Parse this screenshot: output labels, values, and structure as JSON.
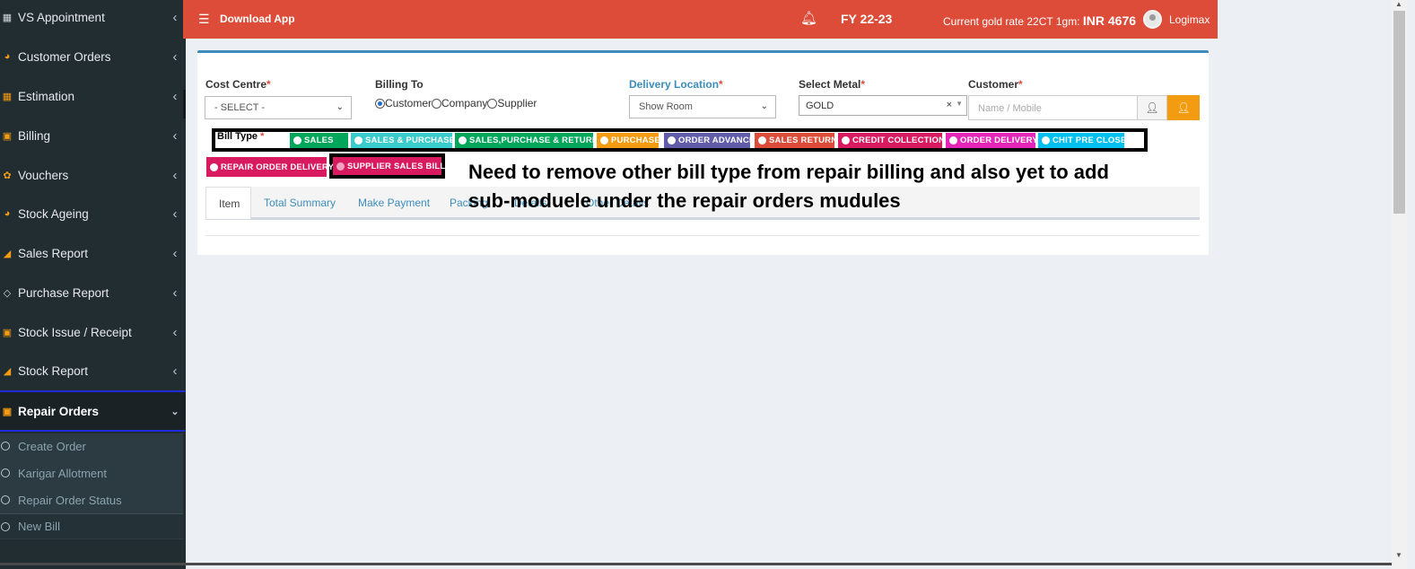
{
  "sidebar": {
    "items": [
      {
        "label": "VS Appointment",
        "icon": "calendar-icon"
      },
      {
        "label": "Customer Orders",
        "icon": "pie-chart-icon"
      },
      {
        "label": "Estimation",
        "icon": "calculator-icon"
      },
      {
        "label": "Billing",
        "icon": "money-icon"
      },
      {
        "label": "Vouchers",
        "icon": "gift-icon"
      },
      {
        "label": "Stock Ageing",
        "icon": "pie-chart-icon"
      },
      {
        "label": "Sales Report",
        "icon": "area-chart-icon"
      },
      {
        "label": "Purchase Report",
        "icon": "diamond-icon"
      },
      {
        "label": "Stock Issue / Receipt",
        "icon": "money-icon"
      },
      {
        "label": "Stock Report",
        "icon": "area-chart-icon"
      }
    ],
    "active": {
      "label": "Repair Orders",
      "icon": "money-icon"
    },
    "submenu": [
      "Create Order",
      "Karigar Allotment",
      "Repair Order Status",
      "New Bill"
    ]
  },
  "header": {
    "menu_icon": "hamburger-icon",
    "download_app": "Download App",
    "bell_icon": "bell-icon",
    "fy": "FY 22-23",
    "gold_rate_label": "Current gold rate 22CT 1gm:",
    "gold_rate_value": "INR 4676",
    "user": "Logimax",
    "brand_color": "#dd4b39"
  },
  "form": {
    "cost_centre": {
      "label": "Cost Centre",
      "required": "*",
      "value": "- SELECT -"
    },
    "billing_to": {
      "label": "Billing To",
      "options": [
        "Customer",
        "Company",
        "Supplier"
      ],
      "selected": "Customer"
    },
    "delivery_location": {
      "label": "Delivery Location",
      "required": "*",
      "value": "Show Room"
    },
    "select_metal": {
      "label": "Select Metal",
      "required": "*",
      "value": "GOLD",
      "clear": "×"
    },
    "customer": {
      "label": "Customer",
      "required": "*",
      "placeholder": "Name / Mobile"
    }
  },
  "bill_type": {
    "label": "Bill Type",
    "required": "*",
    "options": [
      {
        "label": "SALES",
        "color": "#00a65a"
      },
      {
        "label": "SALES & PURCHASE",
        "color": "#39cccc"
      },
      {
        "label": "SALES,PURCHASE & RETURN",
        "color": "#00a65a"
      },
      {
        "label": "PURCHASE",
        "color": "#f39c12"
      },
      {
        "label": "ORDER ADVANCE",
        "color": "#605ca8"
      },
      {
        "label": "SALES RETURN",
        "color": "#dd4b39"
      },
      {
        "label": "CREDIT COLLECTION",
        "color": "#d81b60"
      },
      {
        "label": "ORDER DELIVERY",
        "color": "#e426b8"
      },
      {
        "label": "CHIT PRE CLOSE",
        "color": "#00c0ef"
      },
      {
        "label": "REPAIR ORDER DELIVERY",
        "color": "#d81b60"
      },
      {
        "label": "SUPPLIER SALES BILL",
        "color": "#d81b60"
      }
    ]
  },
  "annotation": "Need to remove other bill type from repair billing and also yet to add sub-moduele under the repair orders mudules",
  "tabs": [
    "Item",
    "Total Summary",
    "Make Payment",
    "Packing",
    "Details",
    "Other Details"
  ]
}
